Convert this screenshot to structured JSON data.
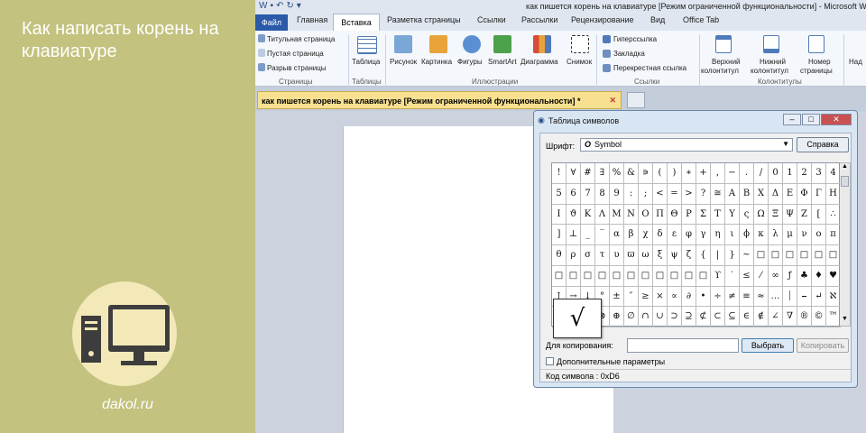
{
  "banner": {
    "title": "Как написать корень на клавиатуре",
    "site": "dakol.ru"
  },
  "word": {
    "window_title": "как пишется корень на клавиатуре [Режим ограниченной функциональности] - Microsoft W",
    "tabs": {
      "file": "Файл",
      "items": [
        "Главная",
        "Вставка",
        "Разметка страницы",
        "Ссылки",
        "Рассылки",
        "Рецензирование",
        "Вид",
        "Office Tab"
      ]
    },
    "ribbon": {
      "pages": [
        "Титульная страница",
        "Пустая страница",
        "Разрыв страницы"
      ],
      "pages_group": "Страницы",
      "table": "Таблица",
      "tables_group": "Таблицы",
      "illustrations": [
        "Рисунок",
        "Картинка",
        "Фигуры",
        "SmartArt",
        "Диаграмма",
        "Снимок"
      ],
      "illustrations_group": "Иллюстрации",
      "links": [
        "Гиперссылка",
        "Закладка",
        "Перекрестная ссылка"
      ],
      "links_group": "Ссылки",
      "header": [
        "Верхний",
        "колонтитул"
      ],
      "footer": [
        "Нижний",
        "колонтитул"
      ],
      "page_number": [
        "Номер",
        "страницы"
      ],
      "headers_group": "Колонтитулы",
      "cut": "Над"
    },
    "document_tab": "как пишется корень на клавиатуре [Режим ограниченной функциональности] *"
  },
  "dialog": {
    "title": "Таблица символов",
    "font_label": "Шрифт:",
    "font_value": "Symbol",
    "font_icon": "O",
    "help": "Справка",
    "rows": [
      [
        "!",
        "∀",
        "#",
        "∃",
        "%",
        "&",
        "∍",
        "(",
        ")",
        "∗",
        "+",
        ",",
        "−",
        ".",
        "/",
        "0",
        "1",
        "2",
        "3",
        "4"
      ],
      [
        "5",
        "6",
        "7",
        "8",
        "9",
        ":",
        ";",
        "<",
        "=",
        ">",
        "?",
        "≅",
        "Α",
        "Β",
        "Χ",
        "Δ",
        "Ε",
        "Φ",
        "Γ",
        "Η"
      ],
      [
        "Ι",
        "ϑ",
        "Κ",
        "Λ",
        "Μ",
        "Ν",
        "Ο",
        "Π",
        "Θ",
        "Ρ",
        "Σ",
        "Τ",
        "Υ",
        "ς",
        "Ω",
        "Ξ",
        "Ψ",
        "Ζ",
        "[",
        "∴"
      ],
      [
        "]",
        "⊥",
        "_",
        "‾",
        "α",
        "β",
        "χ",
        "δ",
        "ε",
        "φ",
        "γ",
        "η",
        "ι",
        "ϕ",
        "κ",
        "λ",
        "μ",
        "ν",
        "ο",
        "π"
      ],
      [
        "θ",
        "ρ",
        "σ",
        "τ",
        "υ",
        "ϖ",
        "ω",
        "ξ",
        "ψ",
        "ζ",
        "{",
        "|",
        "}",
        "~",
        "□",
        "□",
        "□",
        "□",
        "□",
        "□"
      ],
      [
        "□",
        "□",
        "□",
        "□",
        "□",
        "□",
        "□",
        "□",
        "□",
        "□",
        "□",
        "ϒ",
        "′",
        "≤",
        "⁄",
        "∞",
        "ƒ",
        "♣",
        "♦",
        "♥",
        "♠",
        "↔",
        "←"
      ],
      [
        "↑",
        "→",
        "↓",
        "°",
        "±",
        "″",
        "≥",
        "×",
        "∝",
        "∂",
        "•",
        "÷",
        "≠",
        "≡",
        "≈",
        "…",
        "⏐",
        "⎯",
        "↵",
        "ℵ"
      ],
      [
        "ℑ",
        "ℜ",
        "℘",
        "⊗",
        "⊕",
        "∅",
        "∩",
        "∪",
        "⊃",
        "⊇",
        "⊄",
        "⊂",
        "⊆",
        "∈",
        "∉",
        "∠",
        "∇",
        "®",
        "©",
        "™"
      ],
      [
        "∏",
        "√",
        "⋅",
        "¬",
        "∧",
        "∨",
        "⇔",
        "⇐",
        "⇑",
        "⇒",
        "⇓",
        "◊",
        "〈",
        "®",
        "©",
        "™",
        "∑",
        "⎛",
        "⎜",
        "⎝"
      ]
    ],
    "enlarged_symbol": "√",
    "copy_label": "Для копирования:",
    "copy_value": "",
    "select_btn": "Выбрать",
    "copy_btn": "Копировать",
    "advanced": "Дополнительные параметры",
    "status": "Код символа : 0xD6"
  }
}
